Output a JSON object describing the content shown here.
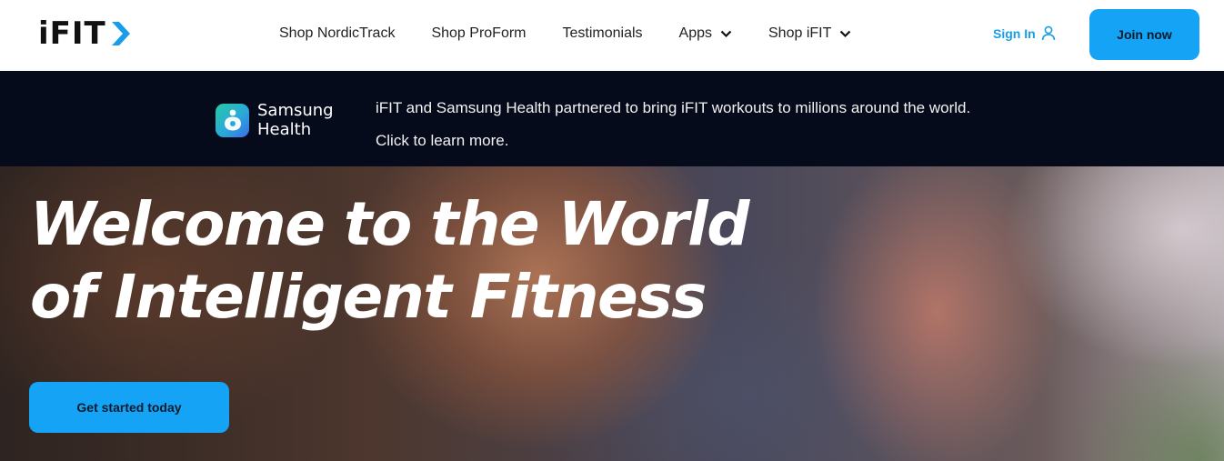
{
  "header": {
    "logo_text": "iFIT",
    "nav": [
      {
        "label": "Shop NordicTrack",
        "has_dropdown": false
      },
      {
        "label": "Shop ProForm",
        "has_dropdown": false
      },
      {
        "label": "Testimonials",
        "has_dropdown": false
      },
      {
        "label": "Apps",
        "has_dropdown": true
      },
      {
        "label": "Shop iFIT",
        "has_dropdown": true
      }
    ],
    "sign_in_label": "Sign In",
    "join_label": "Join now"
  },
  "banner": {
    "partner_name_line1": "Samsung",
    "partner_name_line2": "Health",
    "message": "iFIT and Samsung Health partnered to bring iFIT workouts to millions around the world.",
    "link_text": "Click to learn more."
  },
  "hero": {
    "title_line1": "Welcome to the World",
    "title_line2": "of Intelligent Fitness",
    "cta_label": "Get started today"
  },
  "colors": {
    "accent": "#14a3f5",
    "link": "#1a9de8",
    "banner_bg": "#060b1c"
  },
  "icons": [
    "ifit-chevron-icon",
    "chevron-down-icon",
    "user-icon",
    "samsung-health-icon"
  ]
}
